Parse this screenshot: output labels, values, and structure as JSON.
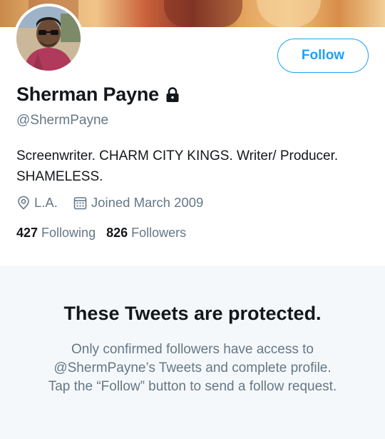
{
  "profile": {
    "name": "Sherman Payne",
    "handle": "@ShermPayne",
    "bio": "Screenwriter. CHARM CITY KINGS. Writer/ Producer. SHAMELESS.",
    "location": "L.A.",
    "joined": "Joined March 2009",
    "following_count": "427",
    "following_label": "Following",
    "followers_count": "826",
    "followers_label": "Followers",
    "protected": true
  },
  "actions": {
    "follow_label": "Follow"
  },
  "protected_notice": {
    "title": "These Tweets are protected.",
    "message": "Only confirmed followers have access to @ShermPayne’s Tweets and complete profile. Tap the “Follow” button to send a follow request."
  },
  "colors": {
    "accent": "#1da1f2",
    "text_primary": "#14171a",
    "text_secondary": "#657786",
    "panel_bg": "#f5f8fa"
  },
  "icons": {
    "lock": "lock-icon",
    "location": "location-pin-icon",
    "calendar": "calendar-icon"
  }
}
